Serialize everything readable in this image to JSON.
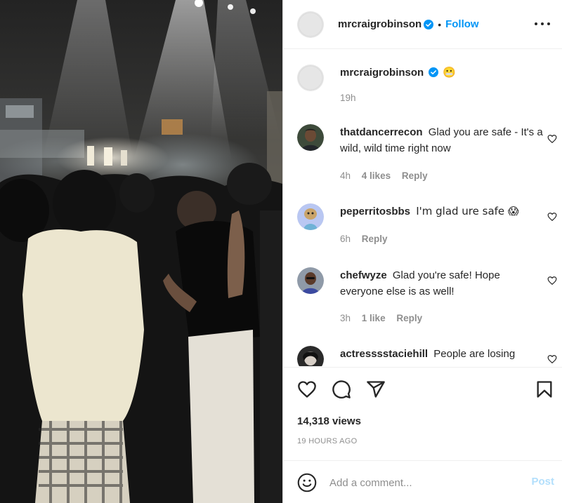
{
  "header": {
    "username": "mrcraigrobinson",
    "separator": "•",
    "follow_label": "Follow",
    "more_icon": "more-dots-icon"
  },
  "caption": {
    "username": "mrcraigrobinson",
    "text": "😬",
    "time": "19h"
  },
  "comments": [
    {
      "username": "thatdancerrecon",
      "text": "Glad you are safe - It's a wild, wild time right now",
      "time": "4h",
      "likes": "4 likes",
      "reply": "Reply"
    },
    {
      "username": "peperritosbbs",
      "text": "I'm glad ure safe 😱",
      "time": "6h",
      "likes": "",
      "reply": "Reply"
    },
    {
      "username": "chefwyze",
      "text": "Glad you're safe! Hope everyone else is as well!",
      "time": "3h",
      "likes": "1 like",
      "reply": "Reply"
    },
    {
      "username": "actresssstaciehill",
      "text": "People are losing",
      "time": "",
      "likes": "",
      "reply": ""
    }
  ],
  "actions": {
    "views": "14,318 views",
    "date": "19 HOURS AGO",
    "icons": [
      "heart-icon",
      "comment-icon",
      "share-icon",
      "bookmark-icon"
    ]
  },
  "add_comment": {
    "placeholder": "Add a comment...",
    "post_label": "Post"
  },
  "colors": {
    "accent": "#0095f6",
    "verified": "#0095f6",
    "muted": "#8e8e8e",
    "post_disabled": "#b2dffc"
  }
}
